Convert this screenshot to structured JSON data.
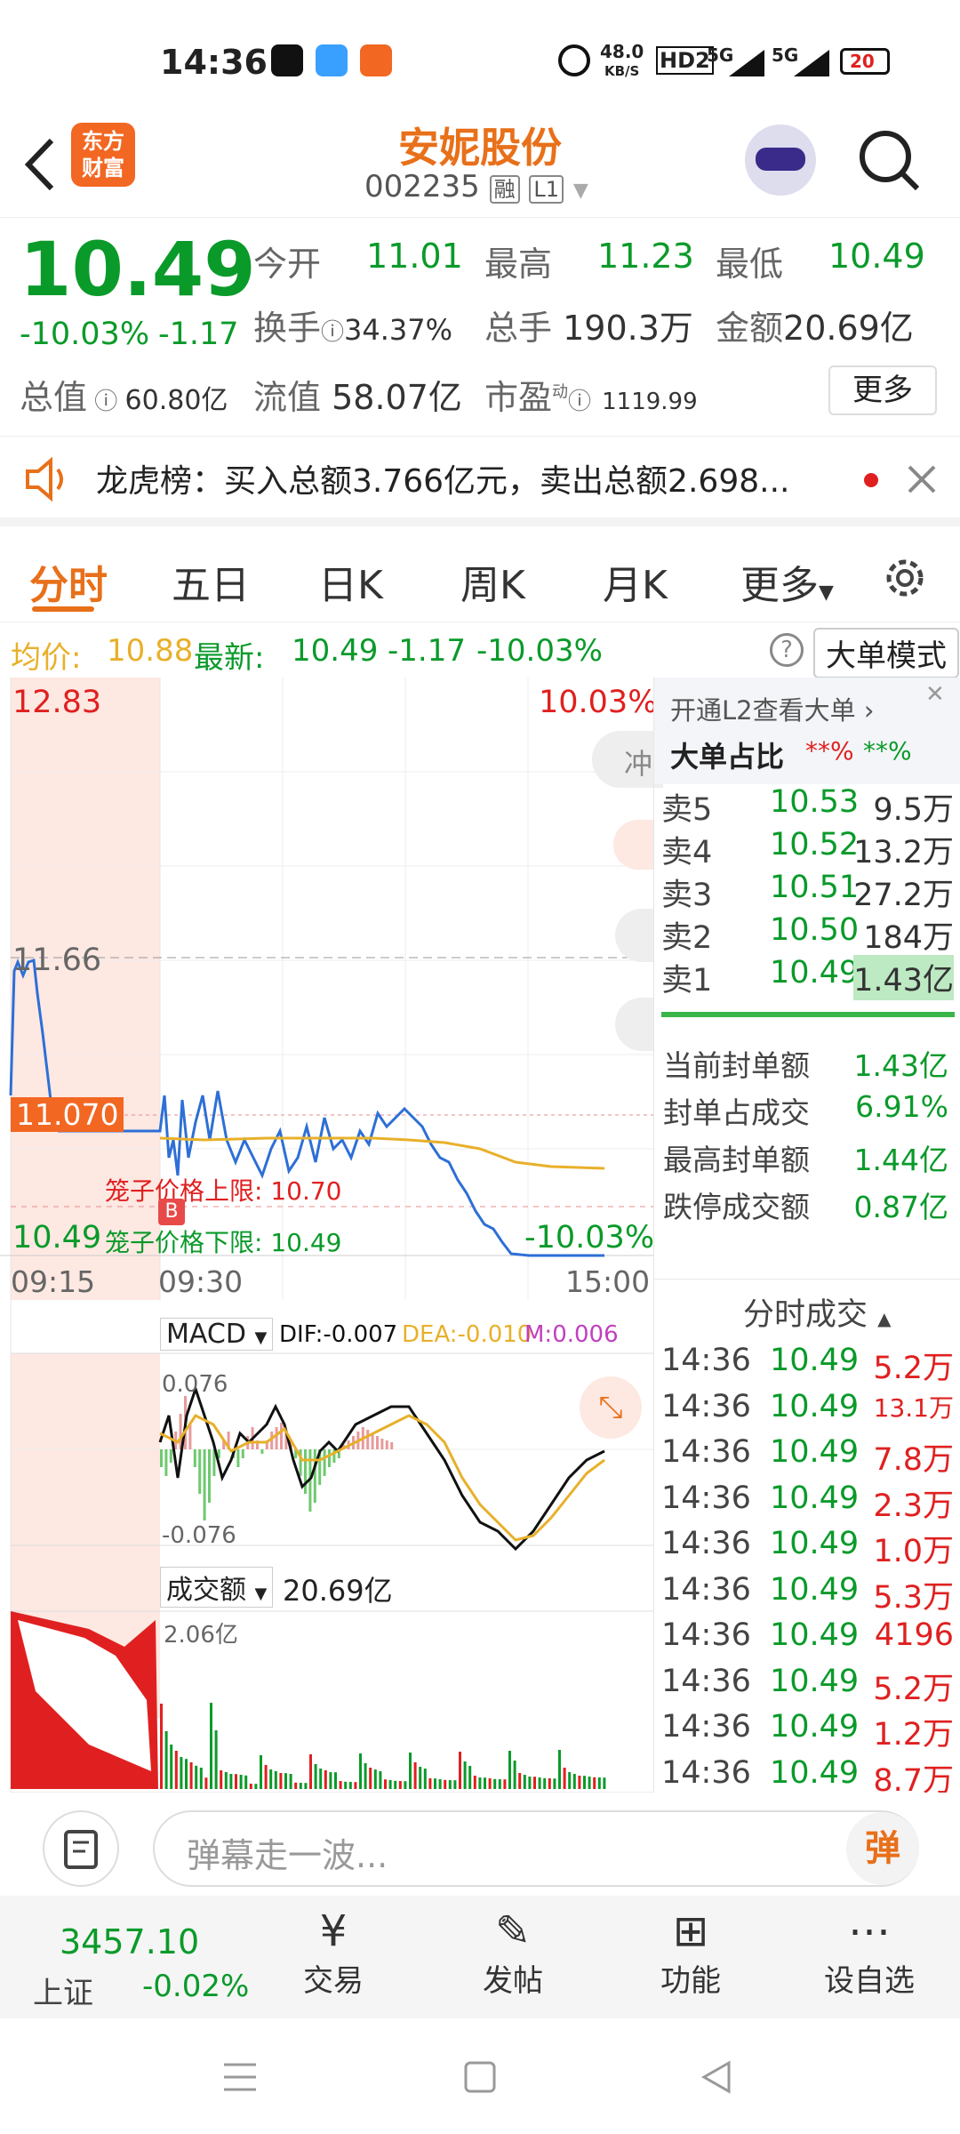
{
  "status": {
    "time": "14:36",
    "net_speed_top": "48.0",
    "net_speed_unit": "KB/S",
    "hd": "HD2",
    "sig1": "5G",
    "sig2": "5G",
    "battery": "20"
  },
  "header": {
    "logo_line1": "东方",
    "logo_line2": "财富",
    "stock_name": "安妮股份",
    "stock_code": "002235",
    "tag_rong": "融",
    "tag_l1": "L1"
  },
  "quote": {
    "price": "10.49",
    "change_pct": "-10.03%",
    "change_amt": "-1.17",
    "open_label": "今开",
    "open": "11.01",
    "high_label": "最高",
    "high": "11.23",
    "low_label": "最低",
    "low": "10.49",
    "turnover_label": "换手",
    "turnover": "34.37%",
    "volume_label": "总手",
    "volume": "190.3万",
    "amount_label": "金额",
    "amount": "20.69亿",
    "mcap_label": "总值",
    "mcap": "60.80亿",
    "float_label": "流值",
    "float": "58.07亿",
    "pe_label": "市盈",
    "pe_sup": "动",
    "pe": "1119.99",
    "more": "更多"
  },
  "notice": {
    "text": "龙虎榜：买入总额3.766亿元，卖出总额2.698..."
  },
  "tabs": [
    "分时",
    "五日",
    "日K",
    "周K",
    "月K",
    "更多"
  ],
  "infobar": {
    "avg_label": "均价:",
    "avg": "10.88",
    "latest_label": "最新:",
    "latest": "10.49",
    "chg": "-1.17",
    "pct": "-10.03%",
    "mode": "大单模式"
  },
  "chart": {
    "top_price": "12.83",
    "top_pct": "10.03%",
    "mid_price": "11.66",
    "ref_price": "11.070",
    "upper_limit_label": "笼子价格上限: 10.70",
    "lower_price": "10.49",
    "lower_limit_label": "笼子价格下限: 10.49",
    "bottom_pct": "-10.03%",
    "t_start": "09:15",
    "t_open": "09:30",
    "t_end": "15:00",
    "side_tab": "冲",
    "macd_label": "MACD",
    "dif": "DIF:-0.007",
    "dea": "DEA:-0.010",
    "m": "M:0.006",
    "macd_top": "0.076",
    "macd_bot": "-0.076",
    "vol_label": "成交额",
    "vol_total": "20.69亿",
    "vol_max": "2.06亿"
  },
  "right": {
    "l2_text": "开通L2查看大单",
    "big_ratio_label": "大单占比",
    "big_r1": "**%",
    "big_r2": "**%",
    "asks": [
      {
        "label": "卖5",
        "price": "10.53",
        "vol": "9.5万"
      },
      {
        "label": "卖4",
        "price": "10.52",
        "vol": "13.2万"
      },
      {
        "label": "卖3",
        "price": "10.51",
        "vol": "27.2万"
      },
      {
        "label": "卖2",
        "price": "10.50",
        "vol": "184万"
      },
      {
        "label": "卖1",
        "price": "10.49",
        "vol": "1.43亿"
      }
    ],
    "stats": [
      {
        "label": "当前封单额",
        "value": "1.43亿"
      },
      {
        "label": "封单占成交",
        "value": "6.91%"
      },
      {
        "label": "最高封单额",
        "value": "1.44亿"
      },
      {
        "label": "跌停成交额",
        "value": "0.87亿"
      }
    ],
    "ticks_title": "分时成交",
    "ticks": [
      {
        "t": "14:36",
        "p": "10.49",
        "v": "5.2万"
      },
      {
        "t": "14:36",
        "p": "10.49",
        "v": "13.1万"
      },
      {
        "t": "14:36",
        "p": "10.49",
        "v": "7.8万"
      },
      {
        "t": "14:36",
        "p": "10.49",
        "v": "2.3万"
      },
      {
        "t": "14:36",
        "p": "10.49",
        "v": "1.0万"
      },
      {
        "t": "14:36",
        "p": "10.49",
        "v": "5.3万"
      },
      {
        "t": "14:36",
        "p": "10.49",
        "v": "4196"
      },
      {
        "t": "14:36",
        "p": "10.49",
        "v": "5.2万"
      },
      {
        "t": "14:36",
        "p": "10.49",
        "v": "1.2万"
      },
      {
        "t": "14:36",
        "p": "10.49",
        "v": "8.7万"
      }
    ]
  },
  "danmu": {
    "placeholder": "弹幕走一波...",
    "btn": "弹"
  },
  "bottomnav": {
    "index_value": "3457.10",
    "index_name": "上证",
    "index_pct": "-0.02%",
    "trade": "交易",
    "post": "发帖",
    "func": "功能",
    "watch": "设自选"
  },
  "colors": {
    "red": "#e02020",
    "green": "#0a9a2a",
    "orange": "#f26722",
    "line": "#2d6fd6",
    "avg": "#e8b02a"
  }
}
